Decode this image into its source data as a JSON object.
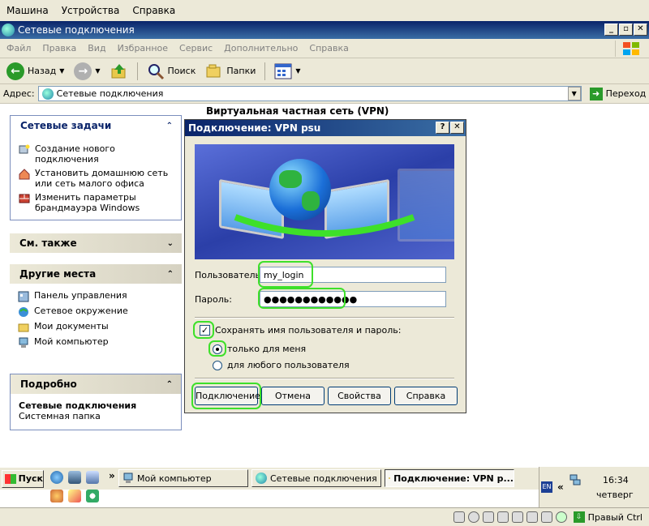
{
  "host_menu": {
    "items": [
      "Машина",
      "Устройства",
      "Справка"
    ]
  },
  "window": {
    "title": "Сетевые подключения"
  },
  "menubar": {
    "items": [
      "Файл",
      "Правка",
      "Вид",
      "Избранное",
      "Сервис",
      "Дополнительно",
      "Справка"
    ]
  },
  "toolbar": {
    "back": "Назад",
    "search": "Поиск",
    "folders": "Папки"
  },
  "addressbar": {
    "label": "Адрес:",
    "value": "Сетевые подключения",
    "go": "Переход"
  },
  "tasks_panel": {
    "title": "Сетевые задачи",
    "items": [
      {
        "label": "Создание нового подключения",
        "icon": "new-connection-icon"
      },
      {
        "label": "Установить домашнюю сеть или сеть малого офиса",
        "icon": "home-network-icon"
      },
      {
        "label": "Изменить параметры брандмауэра Windows",
        "icon": "firewall-icon"
      }
    ]
  },
  "see_also_panel": {
    "title": "См. также"
  },
  "other_places_panel": {
    "title": "Другие места",
    "items": [
      {
        "label": "Панель управления",
        "icon": "control-panel-icon"
      },
      {
        "label": "Сетевое окружение",
        "icon": "network-places-icon"
      },
      {
        "label": "Мои документы",
        "icon": "documents-folder-icon"
      },
      {
        "label": "Мой компьютер",
        "icon": "computer-icon"
      }
    ]
  },
  "details_panel": {
    "title": "Подробно",
    "name": "Сетевые подключения",
    "type": "Системная папка"
  },
  "content": {
    "group_heading": "Виртуальная частная сеть (VPN)"
  },
  "dialog": {
    "title": "Подключение: VPN psu",
    "username_label": "Пользователь:",
    "username_value": "my_login",
    "password_label": "Пароль:",
    "password_value": "●●●●●●●●●●●●",
    "save_label": "Сохранять имя пользователя и пароль:",
    "save_checked": true,
    "only_me": "только для меня",
    "any_user": "для любого пользователя",
    "buttons": {
      "connect": "Подключение",
      "cancel": "Отмена",
      "properties": "Свойства",
      "help": "Справка"
    },
    "highlight_color": "#3ee02a"
  },
  "taskbar": {
    "start": "Пуск",
    "tasks": [
      {
        "label": "Мой компьютер",
        "active": false
      },
      {
        "label": "Сетевые подключения",
        "active": false
      },
      {
        "label": "Подключение: VPN p...",
        "active": true
      }
    ],
    "lang": "EN",
    "clock": "16:34",
    "day": "четверг",
    "chevron": "«"
  },
  "vm_status": {
    "host_key": "Правый Ctrl"
  }
}
